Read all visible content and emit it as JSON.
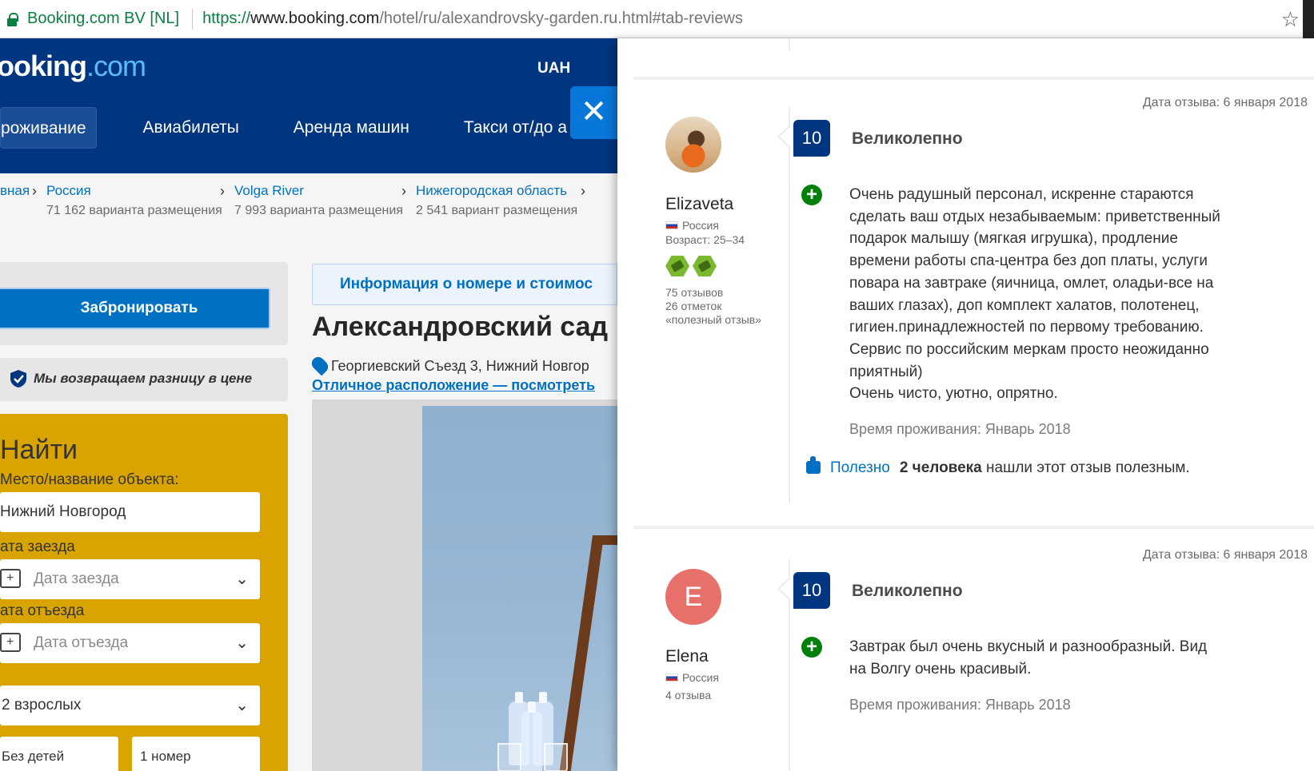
{
  "browser": {
    "cert": "Booking.com BV [NL]",
    "url_scheme": "https://",
    "url_host": "www.booking.com",
    "url_path": "/hotel/ru/alexandrovsky-garden.ru.html#tab-reviews",
    "star": "☆"
  },
  "site": {
    "logo_main": "ooking",
    "logo_dot": ".com",
    "currency": "UAH",
    "nav": [
      "роживание",
      "Авиабилеты",
      "Аренда машин",
      "Такси от/до а"
    ],
    "close": "✕",
    "breadcrumbs": [
      {
        "label": "вная",
        "count": ""
      },
      {
        "label": "Россия",
        "count": "71 162 варианта размещения"
      },
      {
        "label": "Volga River",
        "count": "7 993 варианта размещения"
      },
      {
        "label": "Нижегородская область",
        "count": "2 541 вариант размещения"
      }
    ],
    "book_button": "Забронировать",
    "price_match": "Мы возвращаем разницу в цене",
    "search": {
      "title": "Найти",
      "dest_label": "Место/название объекта:",
      "dest_value": "Нижний Новгород",
      "checkin_label": "ата заезда",
      "checkin_placeholder": "Дата заезда",
      "checkout_label": "ата отъезда",
      "checkout_placeholder": "Дата отъезда",
      "guests": "2 взрослых",
      "children": "Без детей",
      "rooms": "1 номер"
    },
    "tab_info": "Информация о номере и стоимос",
    "hotel_name": "Александровский сад",
    "address": "Георгиевский Съезд 3, Нижний Новгор",
    "location_link": "Отличное расположение — посмотреть"
  },
  "reviews": [
    {
      "date": "Дата отзыва: 6 января 2018",
      "name": "Elizaveta",
      "country": "Россия",
      "age": "Возраст: 25–34",
      "stats": [
        "75 отзывов",
        "26 отметок",
        "«полезный отзыв»"
      ],
      "score": "10",
      "headline": "Великолепно",
      "body_lines": [
        "Очень радушный персонал, искренне стараются",
        "сделать ваш отдых незабываемым: приветственный",
        "подарок малышу (мягкая игрушка), продление",
        "времени работы спа-центра без доп платы, услуги",
        "повара на завтраке (яичница, омлет, оладьи-все на",
        "ваших глазах), доп комплект халатов, полотенец,",
        "гигиен.принадлежностей по первому требованию.",
        "Сервис по российским меркам просто неожиданно",
        "приятный)",
        "Очень чисто, уютно, опрятно."
      ],
      "stay": "Время проживания: Январь 2018",
      "helpful_link": "Полезно",
      "helpful_count": "2 человека",
      "helpful_text": "нашли этот отзыв полезным."
    },
    {
      "date": "Дата отзыва: 6 января 2018",
      "name": "Elena",
      "avatar_letter": "E",
      "country": "Россия",
      "stats": [
        "4 отзыва"
      ],
      "score": "10",
      "headline": "Великолепно",
      "body_lines": [
        "Завтрак был очень вкусный и разнообразный. Вид",
        "на Волгу очень красивый."
      ],
      "stay": "Время проживания: Январь 2018"
    }
  ]
}
